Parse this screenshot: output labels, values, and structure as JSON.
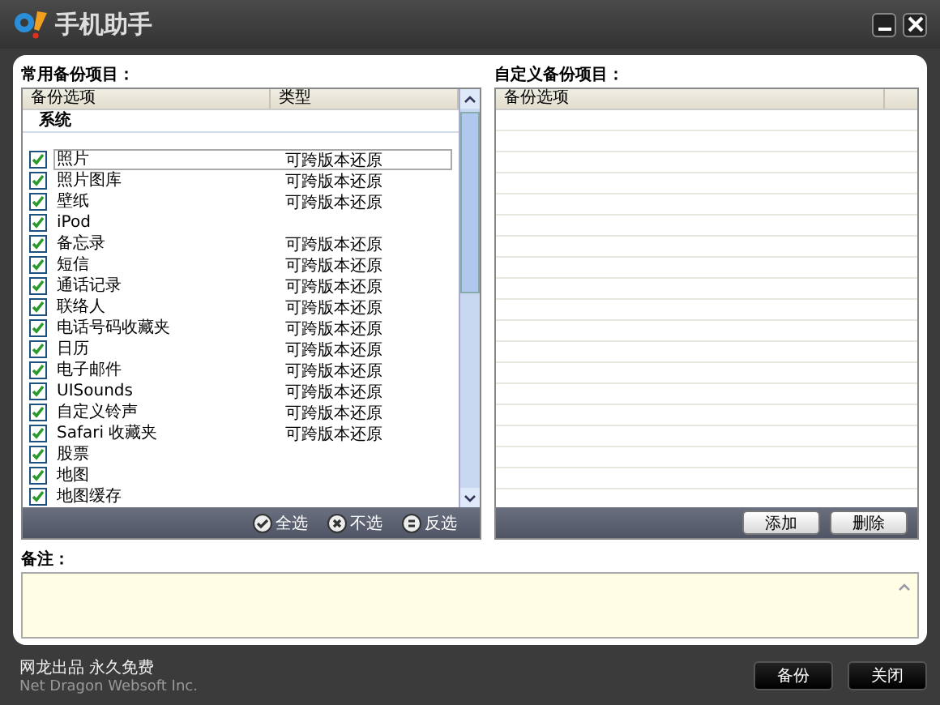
{
  "window": {
    "title": "手机助手"
  },
  "common": {
    "label": "常用备份项目：",
    "columns": [
      "备份选项",
      "类型"
    ],
    "group": "系统",
    "rows": [
      {
        "name": "照片",
        "type": "可跨版本还原",
        "checked": true,
        "selected": true
      },
      {
        "name": "照片图库",
        "type": "可跨版本还原",
        "checked": true,
        "selected": false
      },
      {
        "name": "壁纸",
        "type": "可跨版本还原",
        "checked": true,
        "selected": false
      },
      {
        "name": "iPod",
        "checked": true,
        "selected": false
      },
      {
        "name": "备忘录",
        "type": "可跨版本还原",
        "checked": true,
        "selected": false
      },
      {
        "name": "短信",
        "type": "可跨版本还原",
        "checked": true,
        "selected": false
      },
      {
        "name": "通话记录",
        "type": "可跨版本还原",
        "checked": true,
        "selected": false
      },
      {
        "name": "联络人",
        "type": "可跨版本还原",
        "checked": true,
        "selected": false
      },
      {
        "name": "电话号码收藏夹",
        "type": "可跨版本还原",
        "checked": true,
        "selected": false
      },
      {
        "name": "日历",
        "type": "可跨版本还原",
        "checked": true,
        "selected": false
      },
      {
        "name": "电子邮件",
        "type": "可跨版本还原",
        "checked": true,
        "selected": false
      },
      {
        "name": "UISounds",
        "type": "可跨版本还原",
        "checked": true,
        "selected": false
      },
      {
        "name": "自定义铃声",
        "type": "可跨版本还原",
        "checked": true,
        "selected": false
      },
      {
        "name": "Safari 收藏夹",
        "type": "可跨版本还原",
        "checked": true,
        "selected": false
      },
      {
        "name": "股票",
        "checked": true,
        "selected": false
      },
      {
        "name": "地图",
        "checked": true,
        "selected": false
      },
      {
        "name": "地图缓存",
        "checked": true,
        "selected": false
      }
    ],
    "actions": [
      {
        "kind": "all",
        "label": "全选"
      },
      {
        "kind": "none",
        "label": "不选"
      },
      {
        "kind": "invert",
        "label": "反选"
      }
    ]
  },
  "custom": {
    "label": "自定义备份项目：",
    "columns": [
      "备份选项"
    ],
    "buttons": [
      "添加",
      "删除"
    ]
  },
  "notes": {
    "label": "备注："
  },
  "footer": {
    "line1": "网龙出品 永久免费",
    "line2": "Net Dragon Websoft Inc.",
    "buttons": [
      "备份",
      "关闭"
    ]
  }
}
